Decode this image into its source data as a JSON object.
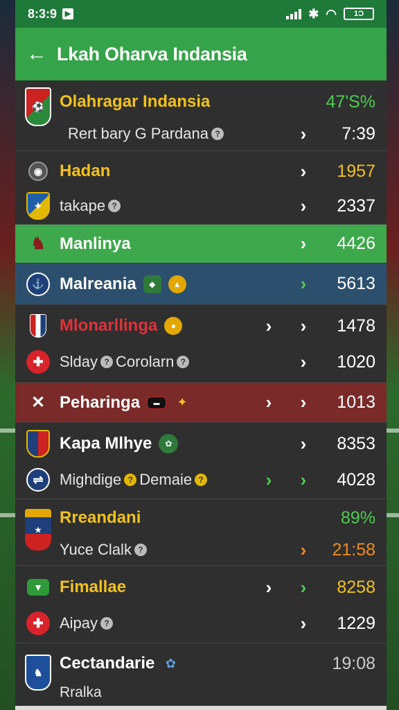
{
  "status": {
    "time": "8:3:9",
    "battery": "1Ɔ"
  },
  "header": {
    "title": "Lkah Oharva Indansia"
  },
  "items": [
    {
      "name": "Olahragar Indansia",
      "value": "47'S%",
      "sub": "Rert bary G Pardana",
      "sub_value": "7:39"
    },
    {
      "name": "Hadan",
      "value": "1957",
      "sub": "takape",
      "sub_value": "2337"
    },
    {
      "name": "Manlinya",
      "value": "4426"
    },
    {
      "name": "Malreania",
      "value": "5613"
    },
    {
      "name": "Mlonarllinga",
      "value": "1478",
      "sub": "Slday",
      "sub2": "Corolarn",
      "sub_value": "1020"
    },
    {
      "name": "Peharinga",
      "value": "1013"
    },
    {
      "name": "Kapa Mlhye",
      "value": "8353",
      "sub": "Mighdige",
      "sub2": "Demaie",
      "sub_value": "4028"
    },
    {
      "name": "Rreandani",
      "value": "89%",
      "sub": "Yuce Clalk",
      "sub_value": "21:58"
    },
    {
      "name": "Fimallae",
      "value": "8258",
      "sub": "Aipay",
      "sub_value": "1229"
    },
    {
      "name": "Cectandarie",
      "value": "19:08",
      "sub": "Rralka"
    }
  ],
  "icons": {
    "back": "arrow-left-icon",
    "chevron": "chevron-right-icon",
    "help": "question-circle-icon"
  },
  "colors": {
    "accent_green": "#35a349",
    "status_green": "#1f7a3a",
    "highlight_blue": "#2d4f6e",
    "highlight_red": "#7a2a28",
    "value_yellow": "#f2c21a",
    "value_orange": "#f08b1e"
  }
}
